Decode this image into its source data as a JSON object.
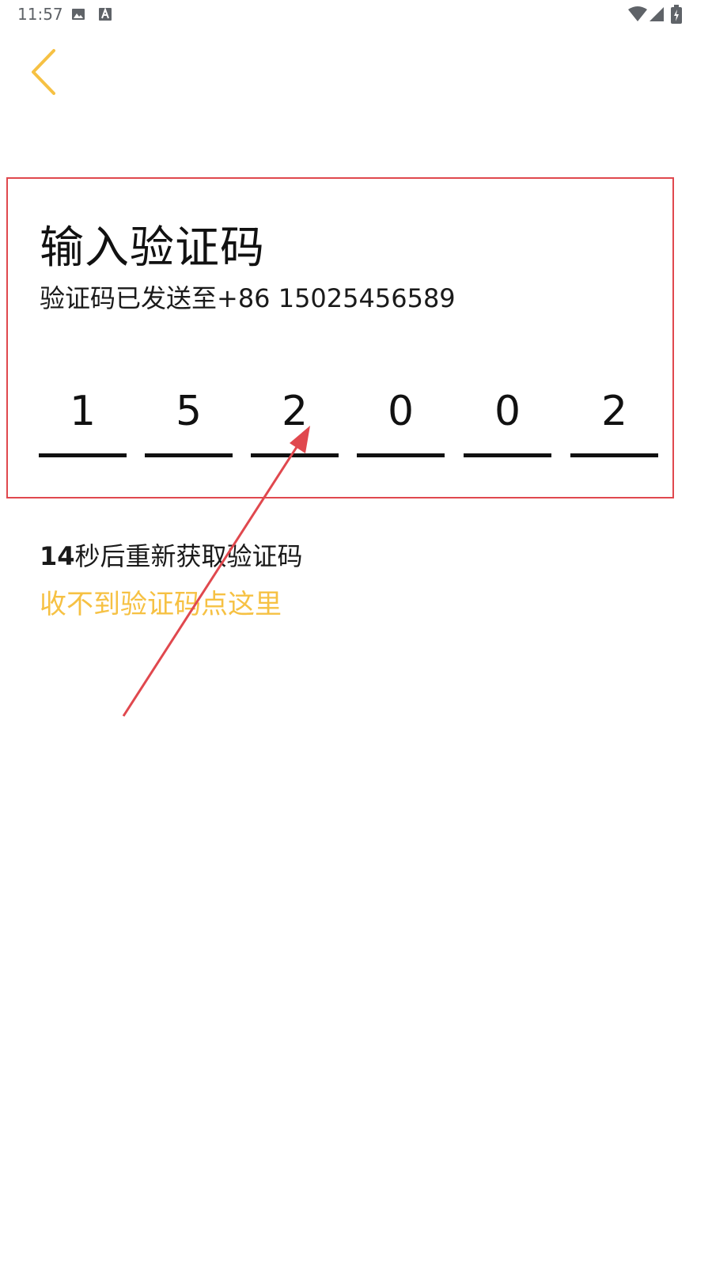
{
  "status_bar": {
    "time": "11:57",
    "icons": [
      "image-icon",
      "text-a-icon",
      "wifi-icon",
      "signal-icon",
      "battery-icon"
    ]
  },
  "back_icon": "chevron-left-icon",
  "title": "输入验证码",
  "sent_line": "验证码已发送至+86 15025456589",
  "otp": {
    "digits": [
      "1",
      "5",
      "2",
      "0",
      "0",
      "2"
    ]
  },
  "resend": {
    "count": "14",
    "suffix": "秒后重新获取验证码"
  },
  "help_link": "收不到验证码点这里",
  "colors": {
    "accent": "#f6c143",
    "highlight": "#e0484e",
    "text": "#111111"
  }
}
